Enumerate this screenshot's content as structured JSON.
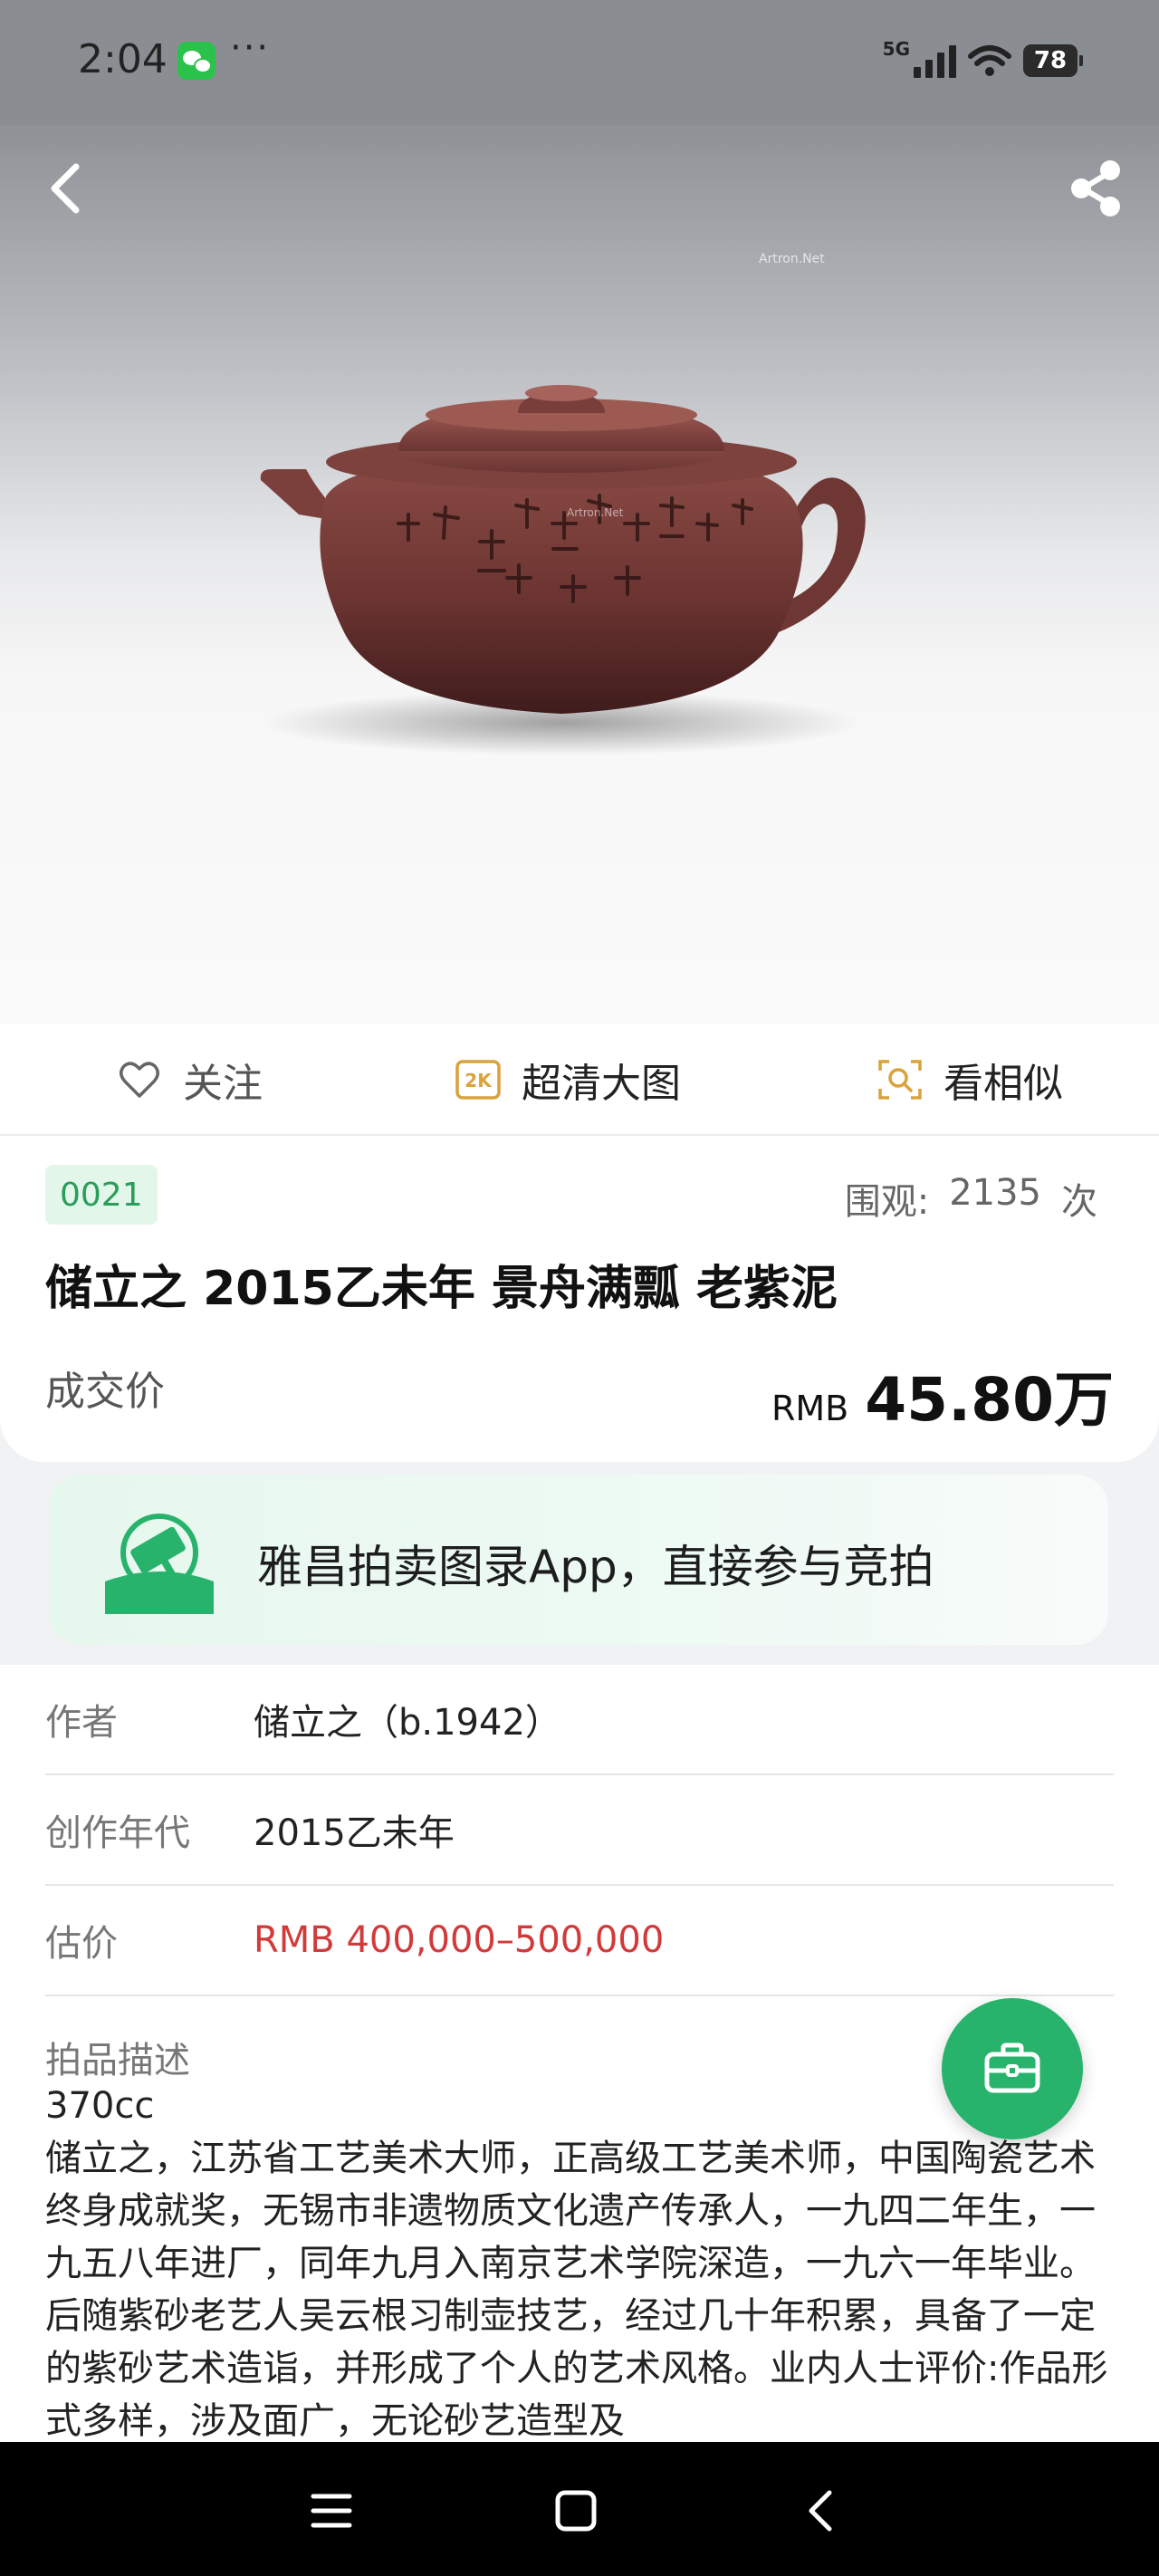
{
  "status_bar": {
    "time": "2:04",
    "dots": "···",
    "network": "5G",
    "battery": "78"
  },
  "hero": {
    "watermark": "Artron.Net"
  },
  "actions": {
    "follow": "关注",
    "hd": "超清大图",
    "hd_badge": "2K",
    "similar": "看相似"
  },
  "lot": {
    "number": "0021",
    "views_label": "围观:",
    "views_count": "2135",
    "views_unit": "次",
    "title": "储立之 2015乙未年 景舟满瓢 老紫泥",
    "deal_label": "成交价",
    "deal_currency": "RMB",
    "deal_amount": "45.80万"
  },
  "promo": {
    "text": "雅昌拍卖图录App，直接参与竞拍"
  },
  "details": {
    "author_label": "作者",
    "author_value": "储立之（b.1942）",
    "year_label": "创作年代",
    "year_value": "2015乙未年",
    "estimate_label": "估价",
    "estimate_value": "RMB  400,000–500,000",
    "desc_label": "拍品描述",
    "desc_text": "370cc\n储立之，江苏省工艺美术大师，正高级工艺美术师，中国陶瓷艺术终身成就奖，无锡市非遗物质文化遗产传承人，一九四二年生，一九五八年进厂，同年九月入南京艺术学院深造，一九六一年毕业。后随紫砂老艺人吴云根习制壶技艺，经过几十年积累，具备了一定的紫砂艺术造诣，并形成了个人的艺术风格。业内人士评价:作品形式多样，涉及面广，无论砂艺造型及"
  },
  "colors": {
    "accent_green": "#27b36b",
    "estimate_red": "#d23a3a",
    "hd_gold": "#d9a23a"
  }
}
